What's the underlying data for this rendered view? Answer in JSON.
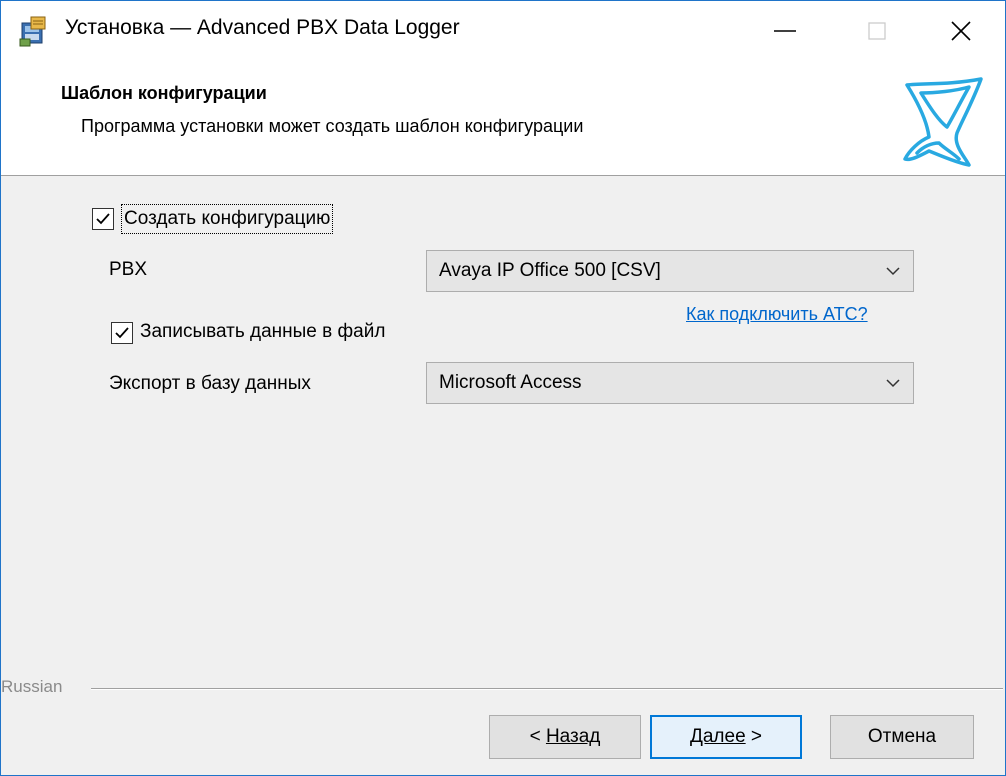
{
  "window": {
    "title": "Установка — Advanced PBX Data Logger"
  },
  "header": {
    "title": "Шаблон конфигурации",
    "subtitle": "Программа установки может создать шаблон конфигурации"
  },
  "form": {
    "create_config": {
      "label": "Создать конфигурацию",
      "checked": true
    },
    "pbx": {
      "label": "PBX",
      "selected": "Avaya IP Office 500 [CSV]"
    },
    "help_link": "Как подключить АТС?",
    "write_to_file": {
      "label": "Записывать данные в файл",
      "checked": true
    },
    "export_db": {
      "label": "Экспорт в базу данных",
      "selected": "Microsoft Access"
    }
  },
  "footer": {
    "language": "Russian",
    "back_prefix": "< ",
    "back_label": "Назад",
    "next_label": "Далее",
    "next_suffix": " >",
    "cancel_label": "Отмена"
  },
  "colors": {
    "accent": "#0078d7",
    "link": "#0066cc",
    "logo": "#29a9e1"
  },
  "icons": {
    "app": "installer-icon",
    "minimize": "minimize-icon",
    "maximize": "maximize-icon",
    "close": "close-icon",
    "logo": "company-logo",
    "dropdown": "chevron-down-icon",
    "check": "checkmark-icon"
  }
}
